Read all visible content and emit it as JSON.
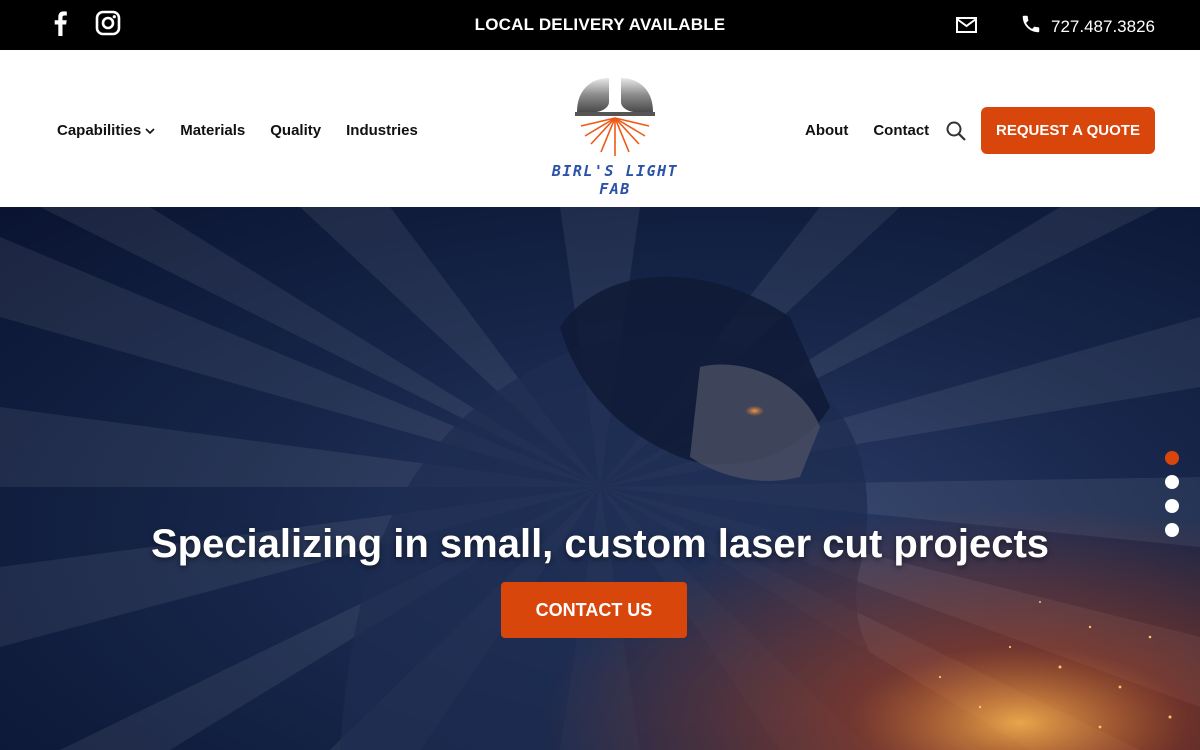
{
  "topbar": {
    "promo": "LOCAL DELIVERY AVAILABLE",
    "phone": "727.487.3826",
    "icons": [
      "facebook-icon",
      "instagram-icon",
      "mail-icon",
      "phone-icon"
    ]
  },
  "header": {
    "nav_left": [
      {
        "label": "Capabilities",
        "has_dropdown": true
      },
      {
        "label": "Materials"
      },
      {
        "label": "Quality"
      },
      {
        "label": "Industries"
      }
    ],
    "nav_right": [
      {
        "label": "About"
      },
      {
        "label": "Contact"
      }
    ],
    "logo_text": "BIRL'S LIGHT FAB",
    "quote_button": "REQUEST A QUOTE"
  },
  "hero": {
    "title": "Specializing in small, custom laser cut projects",
    "cta": "CONTACT US",
    "slides": 4,
    "active_slide": 1
  },
  "colors": {
    "accent": "#d9460c",
    "topbar_bg": "#000000",
    "header_bg": "#ffffff",
    "logo_blue": "#2a52a8"
  }
}
